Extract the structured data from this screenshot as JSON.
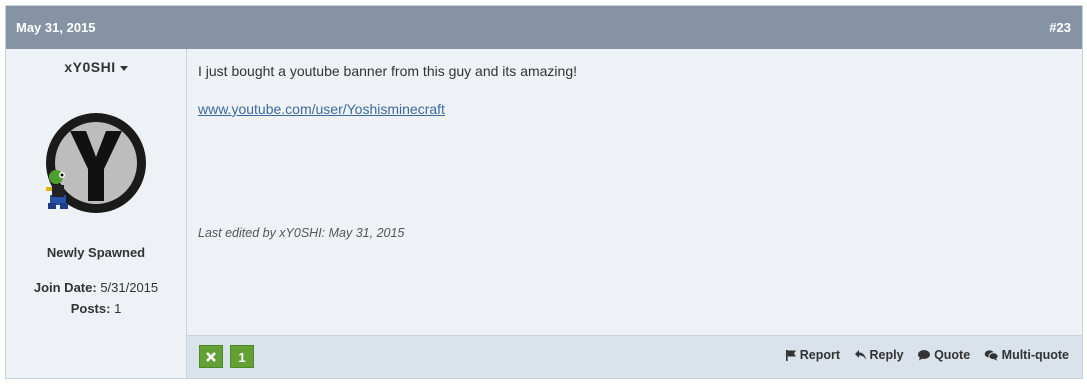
{
  "post": {
    "date": "May 31, 2015",
    "number": "#23"
  },
  "user": {
    "name": "xY0SHI",
    "rank": "Newly Spawned",
    "join_date_label": "Join Date:",
    "join_date": "5/31/2015",
    "posts_label": "Posts:",
    "posts": "1"
  },
  "message": {
    "text": "I just bought a youtube banner from this guy and its amazing!",
    "link": "www.youtube.com/user/Yoshisminecraft",
    "edited": "Last edited by xY0SHI: May 31, 2015"
  },
  "footer": {
    "vote_count": "1",
    "actions": [
      "Report",
      "Reply",
      "Quote",
      "Multi-quote"
    ]
  },
  "colors": {
    "header_bg": "#8593a4",
    "post_bg": "#eef2f6",
    "footer_bg": "#dae3ec",
    "vote_green": "#63a136",
    "link": "#3d6a9c"
  }
}
